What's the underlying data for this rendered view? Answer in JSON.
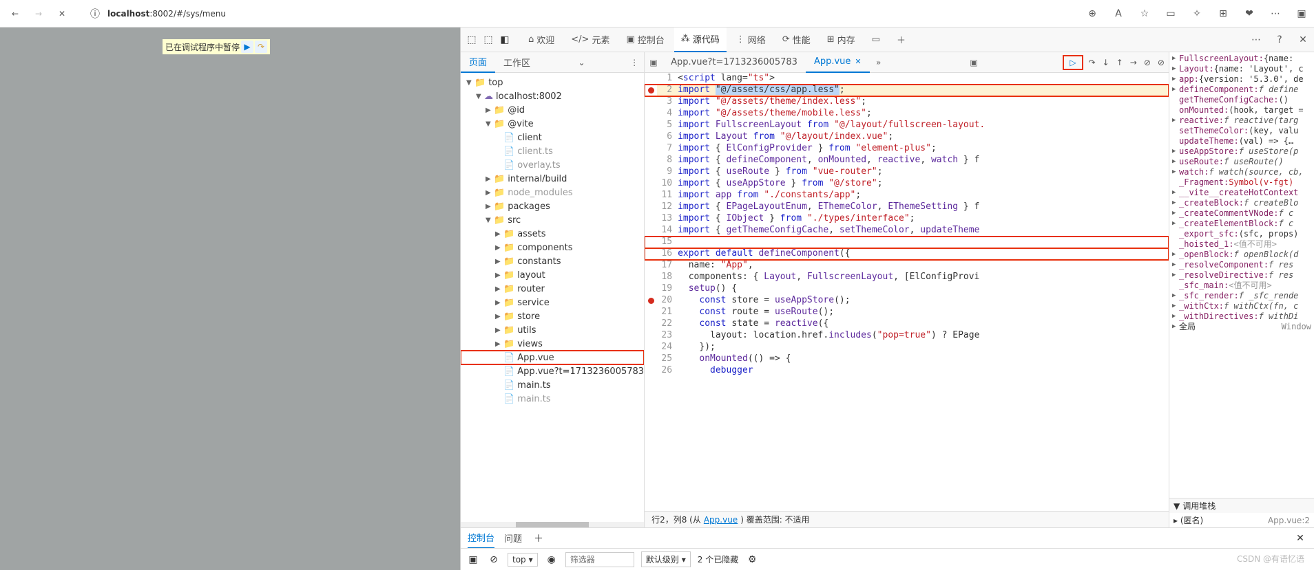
{
  "browser": {
    "url_host": "localhost",
    "url_path": ":8002/#/sys/menu"
  },
  "pause": {
    "text": "已在调试程序中暂停"
  },
  "devtools": {
    "tabs": {
      "welcome": "欢迎",
      "elements": "元素",
      "console": "控制台",
      "sources": "源代码",
      "network": "网络",
      "performance": "性能",
      "memory": "内存"
    },
    "sources": {
      "left_tabs": {
        "page": "页面",
        "workspace": "工作区"
      },
      "tree": [
        {
          "depth": 0,
          "tw": "▼",
          "icon": "folder",
          "label": "top"
        },
        {
          "depth": 1,
          "tw": "▼",
          "icon": "cloud",
          "label": "localhost:8002"
        },
        {
          "depth": 2,
          "tw": "▶",
          "icon": "folder",
          "label": "@id"
        },
        {
          "depth": 2,
          "tw": "▼",
          "icon": "folder",
          "label": "@vite"
        },
        {
          "depth": 3,
          "tw": "",
          "icon": "file",
          "label": "client",
          "cls": "orange"
        },
        {
          "depth": 3,
          "tw": "",
          "icon": "file",
          "label": "client.ts",
          "dim": true
        },
        {
          "depth": 3,
          "tw": "",
          "icon": "file",
          "label": "overlay.ts",
          "dim": true
        },
        {
          "depth": 2,
          "tw": "▶",
          "icon": "folder",
          "label": "internal/build"
        },
        {
          "depth": 2,
          "tw": "▶",
          "icon": "folder",
          "label": "node_modules",
          "dim": true
        },
        {
          "depth": 2,
          "tw": "▶",
          "icon": "folder",
          "label": "packages"
        },
        {
          "depth": 2,
          "tw": "▼",
          "icon": "folder",
          "label": "src"
        },
        {
          "depth": 3,
          "tw": "▶",
          "icon": "folder",
          "label": "assets"
        },
        {
          "depth": 3,
          "tw": "▶",
          "icon": "folder",
          "label": "components"
        },
        {
          "depth": 3,
          "tw": "▶",
          "icon": "folder",
          "label": "constants"
        },
        {
          "depth": 3,
          "tw": "▶",
          "icon": "folder",
          "label": "layout"
        },
        {
          "depth": 3,
          "tw": "▶",
          "icon": "folder",
          "label": "router"
        },
        {
          "depth": 3,
          "tw": "▶",
          "icon": "folder",
          "label": "service"
        },
        {
          "depth": 3,
          "tw": "▶",
          "icon": "folder",
          "label": "store"
        },
        {
          "depth": 3,
          "tw": "▶",
          "icon": "folder",
          "label": "utils"
        },
        {
          "depth": 3,
          "tw": "▶",
          "icon": "folder",
          "label": "views"
        },
        {
          "depth": 3,
          "tw": "",
          "icon": "file",
          "label": "App.vue",
          "cls": "orange",
          "hl": true
        },
        {
          "depth": 3,
          "tw": "",
          "icon": "file",
          "label": "App.vue?t=1713236005783",
          "cls": "orange"
        },
        {
          "depth": 3,
          "tw": "",
          "icon": "file",
          "label": "main.ts",
          "cls": "orange"
        },
        {
          "depth": 3,
          "tw": "",
          "icon": "file",
          "label": "main.ts",
          "dim": true
        }
      ],
      "open_tabs": {
        "inactive": "App.vue?t=1713236005783",
        "active": "App.vue"
      },
      "code": {
        "lines": [
          {
            "n": 1,
            "bp": false,
            "current": false,
            "box": false,
            "html": "&lt;<span class=tok-kw>script</span> lang=<span class=tok-str>\"ts\"</span>&gt;"
          },
          {
            "n": 2,
            "bp": true,
            "current": true,
            "box": true,
            "html": "<span class=tok-kw>import</span> <span style=background:#bcd7f6>\"@/assets/css/app.less\"</span>;"
          },
          {
            "n": 3,
            "bp": false,
            "current": false,
            "box": false,
            "html": "<span class=tok-kw>import</span> <span class=tok-str>\"@/assets/theme/index.less\"</span>;"
          },
          {
            "n": 4,
            "bp": false,
            "current": false,
            "box": false,
            "html": "<span class=tok-kw>import</span> <span class=tok-str>\"@/assets/theme/mobile.less\"</span>;"
          },
          {
            "n": 5,
            "bp": false,
            "current": false,
            "box": false,
            "html": "<span class=tok-kw>import</span> <span class=tok-var>FullscreenLayout</span> <span class=tok-kw>from</span> <span class=tok-str>\"@/layout/fullscreen-layout.</span>"
          },
          {
            "n": 6,
            "bp": false,
            "current": false,
            "box": false,
            "html": "<span class=tok-kw>import</span> <span class=tok-var>Layout</span> <span class=tok-kw>from</span> <span class=tok-str>\"@/layout/index.vue\"</span>;"
          },
          {
            "n": 7,
            "bp": false,
            "current": false,
            "box": false,
            "html": "<span class=tok-kw>import</span> { <span class=tok-var>ElConfigProvider</span> } <span class=tok-kw>from</span> <span class=tok-str>\"element-plus\"</span>;"
          },
          {
            "n": 8,
            "bp": false,
            "current": false,
            "box": false,
            "html": "<span class=tok-kw>import</span> { <span class=tok-var>defineComponent</span>, <span class=tok-var>onMounted</span>, <span class=tok-var>reactive</span>, <span class=tok-var>watch</span> } f"
          },
          {
            "n": 9,
            "bp": false,
            "current": false,
            "box": false,
            "html": "<span class=tok-kw>import</span> { <span class=tok-var>useRoute</span> } <span class=tok-kw>from</span> <span class=tok-str>\"vue-router\"</span>;"
          },
          {
            "n": 10,
            "bp": false,
            "current": false,
            "box": false,
            "html": "<span class=tok-kw>import</span> { <span class=tok-var>useAppStore</span> } <span class=tok-kw>from</span> <span class=tok-str>\"@/store\"</span>;"
          },
          {
            "n": 11,
            "bp": false,
            "current": false,
            "box": false,
            "html": "<span class=tok-kw>import</span> <span class=tok-var>app</span> <span class=tok-kw>from</span> <span class=tok-str>\"./constants/app\"</span>;"
          },
          {
            "n": 12,
            "bp": false,
            "current": false,
            "box": false,
            "html": "<span class=tok-kw>import</span> { <span class=tok-var>EPageLayoutEnum</span>, <span class=tok-var>EThemeColor</span>, <span class=tok-var>EThemeSetting</span> } f"
          },
          {
            "n": 13,
            "bp": false,
            "current": false,
            "box": false,
            "html": "<span class=tok-kw>import</span> { <span class=tok-var>IObject</span> } <span class=tok-kw>from</span> <span class=tok-str>\"./types/interface\"</span>;"
          },
          {
            "n": 14,
            "bp": false,
            "current": false,
            "box": false,
            "html": "<span class=tok-kw>import</span> { <span class=tok-var>getThemeConfigCache</span>, <span class=tok-var>setThemeColor</span>, <span class=tok-var>updateTheme</span>"
          },
          {
            "n": 15,
            "bp": false,
            "current": false,
            "box": true,
            "html": ""
          },
          {
            "n": 16,
            "bp": false,
            "current": false,
            "box": true,
            "html": "<span class=tok-kw>export default</span> <span class=tok-fn>defineComponent</span>({"
          },
          {
            "n": 17,
            "bp": false,
            "current": false,
            "box": false,
            "html": "  name: <span class=tok-str>\"App\"</span>,"
          },
          {
            "n": 18,
            "bp": false,
            "current": false,
            "box": false,
            "html": "  components: { <span class=tok-var>Layout</span>, <span class=tok-var>FullscreenLayout</span>, [ElConfigProvi"
          },
          {
            "n": 19,
            "bp": false,
            "current": false,
            "box": false,
            "html": "  <span class=tok-fn>setup</span>() {"
          },
          {
            "n": 20,
            "bp": true,
            "current": false,
            "box": false,
            "html": "    <span class=tok-kw>const</span> store = <span class=tok-fn>useAppStore</span>();"
          },
          {
            "n": 21,
            "bp": false,
            "current": false,
            "box": false,
            "html": "    <span class=tok-kw>const</span> route = <span class=tok-fn>useRoute</span>();"
          },
          {
            "n": 22,
            "bp": false,
            "current": false,
            "box": false,
            "html": "    <span class=tok-kw>const</span> state = <span class=tok-fn>reactive</span>({"
          },
          {
            "n": 23,
            "bp": false,
            "current": false,
            "box": false,
            "html": "      layout: location.href.<span class=tok-fn>includes</span>(<span class=tok-str>\"pop=true\"</span>) ? EPage"
          },
          {
            "n": 24,
            "bp": false,
            "current": false,
            "box": false,
            "html": "    });"
          },
          {
            "n": 25,
            "bp": false,
            "current": false,
            "box": false,
            "html": "    <span class=tok-fn>onMounted</span>(() =&gt; {"
          },
          {
            "n": 26,
            "bp": false,
            "current": false,
            "box": false,
            "html": "      <span class=tok-kw>debugger</span>"
          }
        ]
      },
      "status": {
        "prefix": "行2，列8 (从",
        "link": "App.vue",
        "suffix": ") 覆盖范围: 不适用"
      },
      "scope": [
        {
          "tw": "▶",
          "name": "FullscreenLayout:",
          "val": "{name:",
          "t": "obj"
        },
        {
          "tw": "▶",
          "name": "Layout:",
          "val": "{name: 'Layout', c",
          "t": "obj"
        },
        {
          "tw": "▶",
          "name": "app:",
          "val": "{version: '5.3.0', de",
          "t": "obj"
        },
        {
          "tw": "▶",
          "name": "defineComponent:",
          "val": "f define",
          "t": "fn"
        },
        {
          "tw": "",
          "name": "getThemeConfigCache:",
          "val": "()",
          "t": "val"
        },
        {
          "tw": "",
          "name": "onMounted:",
          "val": "(hook, target =",
          "t": "val"
        },
        {
          "tw": "▶",
          "name": "reactive:",
          "val": "f reactive(targ",
          "t": "fn"
        },
        {
          "tw": "",
          "name": "setThemeColor:",
          "val": "(key, valu",
          "t": "val"
        },
        {
          "tw": "",
          "name": "updateTheme:",
          "val": "(val) => {…",
          "t": "val"
        },
        {
          "tw": "▶",
          "name": "useAppStore:",
          "val": "f useStore(p",
          "t": "fn"
        },
        {
          "tw": "▶",
          "name": "useRoute:",
          "val": "f useRoute()",
          "t": "fn"
        },
        {
          "tw": "▶",
          "name": "watch:",
          "val": "f watch(source, cb,",
          "t": "fn"
        },
        {
          "tw": "",
          "name": "_Fragment:",
          "val": "Symbol(v-fgt)",
          "t": "str"
        },
        {
          "tw": "▶",
          "name": "__vite__createHotContext",
          "val": "",
          "t": "fn"
        },
        {
          "tw": "▶",
          "name": "_createBlock:",
          "val": "f createBlo",
          "t": "fn"
        },
        {
          "tw": "▶",
          "name": "_createCommentVNode:",
          "val": "f c",
          "t": "fn"
        },
        {
          "tw": "▶",
          "name": "_createElementBlock:",
          "val": "f c",
          "t": "fn"
        },
        {
          "tw": "",
          "name": "_export_sfc:",
          "val": "(sfc, props)",
          "t": "val"
        },
        {
          "tw": "",
          "name": "_hoisted_1:",
          "val": "<值不可用>",
          "t": "unavail"
        },
        {
          "tw": "▶",
          "name": "_openBlock:",
          "val": "f openBlock(d",
          "t": "fn"
        },
        {
          "tw": "▶",
          "name": "_resolveComponent:",
          "val": "f res",
          "t": "fn"
        },
        {
          "tw": "▶",
          "name": "_resolveDirective:",
          "val": "f res",
          "t": "fn"
        },
        {
          "tw": "",
          "name": "_sfc_main:",
          "val": "<值不可用>",
          "t": "unavail"
        },
        {
          "tw": "▶",
          "name": "_sfc_render:",
          "val": "f _sfc_rende",
          "t": "fn"
        },
        {
          "tw": "▶",
          "name": "_withCtx:",
          "val": "f withCtx(fn, c",
          "t": "fn"
        },
        {
          "tw": "▶",
          "name": "_withDirectives:",
          "val": "f withDi",
          "t": "fn"
        }
      ],
      "scope_global": "全局",
      "scope_global_val": "Window",
      "callstack_header": "调用堆栈",
      "callstack_anon": "(匿名)",
      "callstack_loc": "App.vue:2"
    },
    "console_tabs": {
      "console": "控制台",
      "issues": "问题"
    },
    "filters": {
      "top": "top",
      "placeholder": "筛选器",
      "levels": "默认级别",
      "hidden": "2 个已隐藏"
    }
  },
  "watermark": "CSDN @有语忆语"
}
